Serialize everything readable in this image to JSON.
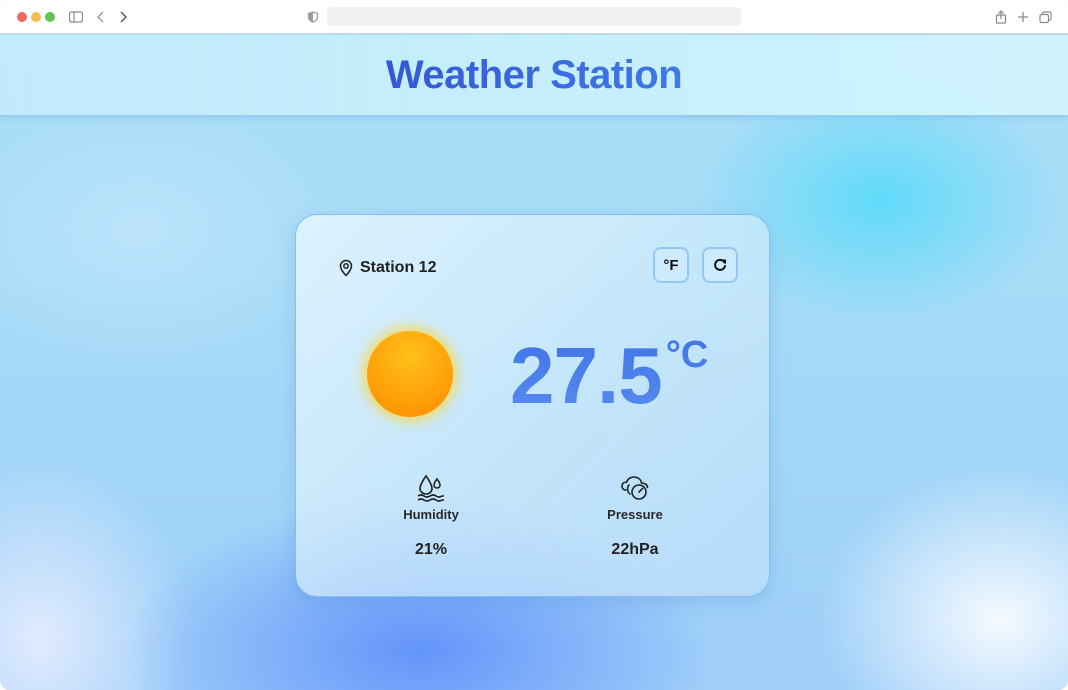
{
  "browser": {
    "url": "",
    "icons": {
      "sidebar": "sidebar-toggle-icon",
      "back": "chevron-left-icon",
      "forward": "chevron-right-icon",
      "privacy": "shield-icon",
      "share": "share-icon",
      "new_tab": "plus-icon",
      "tabs": "tabs-overview-icon"
    }
  },
  "header": {
    "title": "Weather Station"
  },
  "card": {
    "station_name": "Station 12",
    "unit_toggle_label": "°F",
    "refresh_icon": "refresh-icon",
    "location_icon": "map-pin-icon",
    "weather_icon": "sun-icon",
    "temperature": "27.5",
    "temperature_unit": "°C",
    "metrics": [
      {
        "icon": "humidity-icon",
        "label": "Humidity",
        "value": "21%"
      },
      {
        "icon": "pressure-icon",
        "label": "Pressure",
        "value": "22hPa"
      }
    ]
  },
  "colors": {
    "title_gradient_start": "#3558d6",
    "title_gradient_end": "#3f7ae6",
    "temperature": "#3e74e6",
    "sun": "#ffa80c"
  }
}
